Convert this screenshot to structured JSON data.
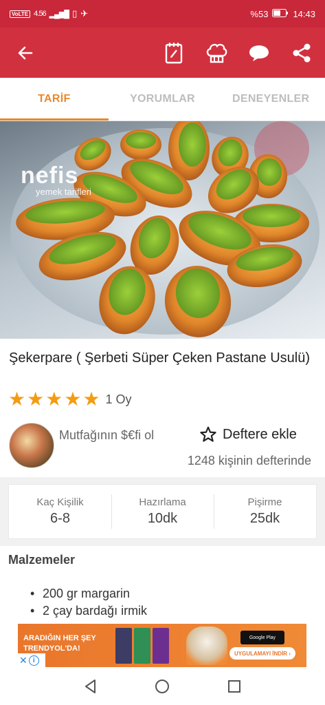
{
  "status_bar": {
    "network": "VoLTE",
    "speed": "4.56",
    "battery_percent": "%53",
    "time": "14:43"
  },
  "app_bar": {
    "icons": [
      "back-arrow-icon",
      "notebook-icon",
      "chef-hat-icon",
      "comment-icon",
      "share-icon"
    ],
    "accent": "#d1313f"
  },
  "tabs": [
    {
      "label": "TARİF",
      "active": true
    },
    {
      "label": "YORUMLAR",
      "active": false
    },
    {
      "label": "DENEYENLER",
      "active": false
    }
  ],
  "hero": {
    "watermark_logo": "nefis",
    "watermark_sub": "yemek tarifleri"
  },
  "recipe": {
    "title": "Şekerpare ( Şerbeti Süper Çeken Pastane Usulü)",
    "rating_stars": 5,
    "rating_count": "1 Oy"
  },
  "author": {
    "name": "Mutfağının $€fi ol"
  },
  "save": {
    "label": "Deftere ekle",
    "count_text": "1248 kişinin defterinde"
  },
  "info": [
    {
      "label": "Kaç Kişilik",
      "value": "6-8"
    },
    {
      "label": "Hazırlama",
      "value": "10dk"
    },
    {
      "label": "Pişirme",
      "value": "25dk"
    }
  ],
  "ingredients": {
    "title": "Malzemeler",
    "items": [
      "200 gr margarin",
      "2 çay bardağı irmik"
    ]
  },
  "ad": {
    "headline_1": "ARADIĞIN HER ŞEY",
    "headline_2": "TRENDYOL'DA!",
    "store_badge": "Google Play",
    "cta": "UYGULAMAYI İNDİR ›"
  },
  "colors": {
    "primary_red": "#d1313f",
    "tab_active": "#e8892b",
    "star": "#f39c12"
  }
}
